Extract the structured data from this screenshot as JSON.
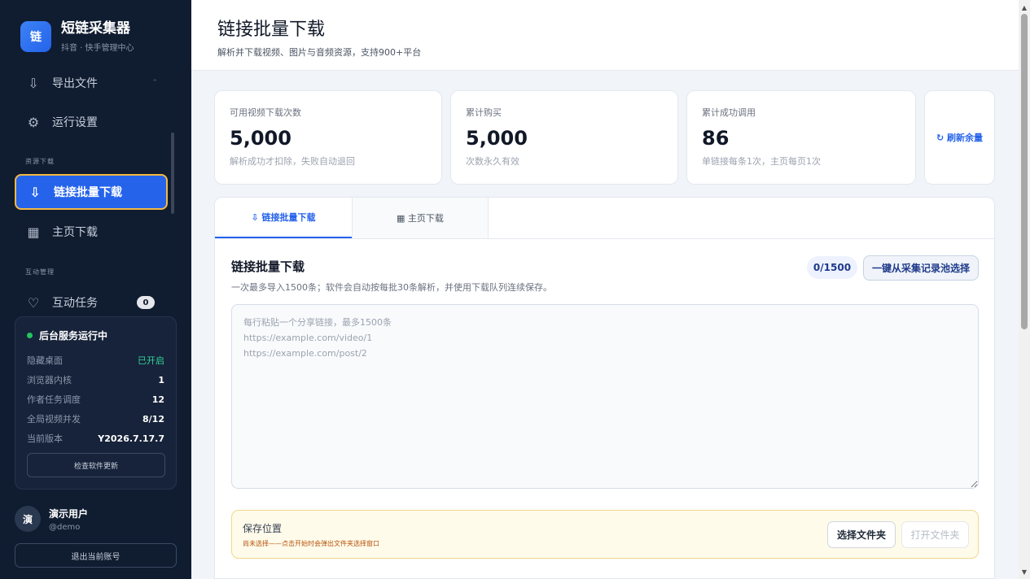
{
  "sidebar": {
    "brand": {
      "logo": "链",
      "title": "短链采集器",
      "subtitle": "抖音 · 快手管理中心"
    },
    "items": [
      {
        "icon": "⇩",
        "label": "导出文件",
        "caret": "⌃"
      },
      {
        "icon": "⚙",
        "label": "运行设置"
      },
      {
        "icon": "⇩",
        "label": "链接批量下载",
        "active": true
      },
      {
        "icon": "▦",
        "label": "主页下载"
      },
      {
        "icon": "♡",
        "label": "互动任务",
        "badge": "0",
        "caret": "⌄"
      }
    ],
    "sections": {
      "resources": "资源下载",
      "interaction": "互动管理"
    },
    "status": {
      "title": "后台服务运行中",
      "rows": [
        {
          "label": "隐藏桌面",
          "value": "已开启"
        },
        {
          "label": "浏览器内核",
          "value": "1"
        },
        {
          "label": "作者任务调度",
          "value": "12"
        },
        {
          "label": "全局视频并发",
          "value": "8/12"
        },
        {
          "label": "当前版本",
          "value": "Y2026.7.17.7"
        }
      ],
      "check_update": "检查软件更新"
    },
    "user": {
      "avatar": "演",
      "name": "演示用户",
      "handle": "@demo",
      "logout": "退出当前账号"
    }
  },
  "header": {
    "title": "链接批量下载",
    "subtitle": "解析并下载视频、图片与音频资源，支持900+平台"
  },
  "stats": [
    {
      "label": "可用视频下载次数",
      "value": "5,000",
      "note": "解析成功才扣除，失败自动退回"
    },
    {
      "label": "累计购买",
      "value": "5,000",
      "note": "次数永久有效"
    },
    {
      "label": "累计成功调用",
      "value": "86",
      "note": "单链接每条1次，主页每页1次"
    }
  ],
  "refresh_label": "↻ 刷新余量",
  "tabs": [
    {
      "label": "⇩ 链接批量下载"
    },
    {
      "label": "▦ 主页下载"
    }
  ],
  "batch": {
    "title": "链接批量下载",
    "description": "一次最多导入1500条；软件会自动按每批30条解析，并使用下载队列连续保存。",
    "counter": "0/1500",
    "pick_button": "一键从采集记录池选择",
    "placeholder": "每行粘贴一个分享链接，最多1500条\nhttps://example.com/video/1\nhttps://example.com/post/2"
  },
  "save": {
    "title": "保存位置",
    "note": "尚未选择——点击开始时会弹出文件夹选择窗口",
    "choose": "选择文件夹",
    "open": "打开文件夹"
  },
  "icons": {
    "scroll_up": "▲",
    "scroll_down": "▼"
  }
}
